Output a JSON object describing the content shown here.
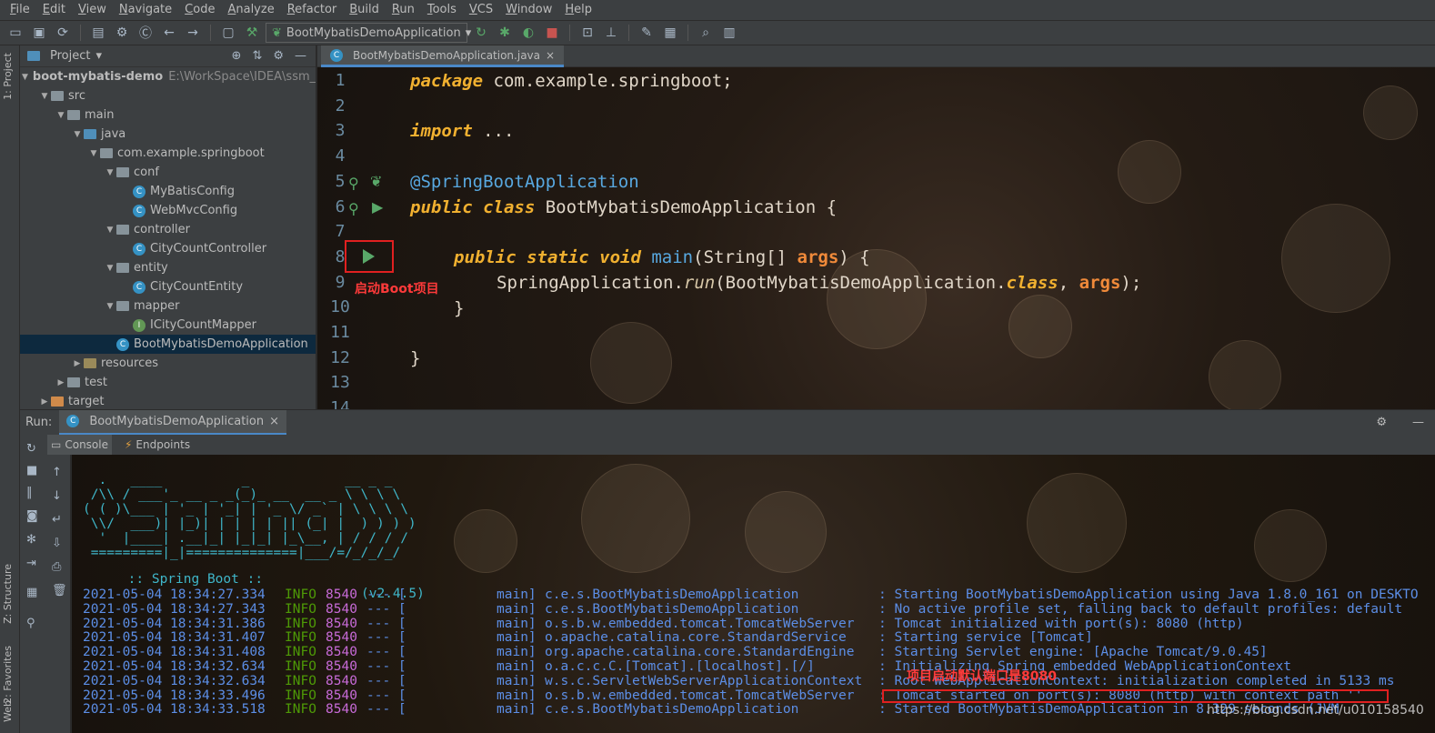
{
  "menu": [
    "File",
    "Edit",
    "View",
    "Navigate",
    "Code",
    "Analyze",
    "Refactor",
    "Build",
    "Run",
    "Tools",
    "VCS",
    "Window",
    "Help"
  ],
  "toolbar": {
    "run_config": "BootMybatisDemoApplication"
  },
  "left_strip": {
    "project_tab": "1: Project",
    "structure_tab": "Z: Structure",
    "favorites_tab": "2: Favorites",
    "web_tab": "Web"
  },
  "project": {
    "header": "Project",
    "root_name": "boot-mybatis-demo",
    "root_path": "E:\\WorkSpace\\IDEA\\ssm_de",
    "tree": [
      {
        "label": "src",
        "indent": 1
      },
      {
        "label": "main",
        "indent": 2
      },
      {
        "label": "java",
        "indent": 3
      },
      {
        "label": "com.example.springboot",
        "indent": 4
      },
      {
        "label": "conf",
        "indent": 5
      },
      {
        "label": "MyBatisConfig",
        "indent": 6
      },
      {
        "label": "WebMvcConfig",
        "indent": 6
      },
      {
        "label": "controller",
        "indent": 5
      },
      {
        "label": "CityCountController",
        "indent": 6
      },
      {
        "label": "entity",
        "indent": 5
      },
      {
        "label": "CityCountEntity",
        "indent": 6
      },
      {
        "label": "mapper",
        "indent": 5
      },
      {
        "label": "ICityCountMapper",
        "indent": 6
      },
      {
        "label": "BootMybatisDemoApplication",
        "indent": 5
      },
      {
        "label": "resources",
        "indent": 3
      },
      {
        "label": "test",
        "indent": 2
      },
      {
        "label": "target",
        "indent": 1
      }
    ]
  },
  "editor": {
    "tab_label": "BootMybatisDemoApplication.java",
    "line_numbers": [
      "1",
      "2",
      "3",
      "4",
      "5",
      "6",
      "7",
      "8",
      "9",
      "10",
      "11",
      "12",
      "13",
      "14"
    ],
    "code": {
      "l1_kw": "package",
      "l1_rest": " com.example.springboot;",
      "l3_kw": "import",
      "l3_rest": " ...",
      "l6": "@SpringBootApplication",
      "l7_kw": "public class",
      "l7_rest": " BootMybatisDemoApplication {",
      "l9_kw": "public static void",
      "l9_m": "main",
      "l9_a": "(String[] ",
      "l9_arg": "args",
      "l9_b": ") {",
      "l10_a": "SpringApplication.",
      "l10_run": "run",
      "l10_b": "(BootMybatisDemoApplication.",
      "l10_cls": "class",
      "l10_c": ", ",
      "l10_arg": "args",
      "l10_d": ");",
      "l11": "}",
      "l13": "}"
    },
    "annotation_label": "启动Boot项目"
  },
  "run_panel": {
    "run_label": "Run:",
    "tab_label": "BootMybatisDemoApplication",
    "console_tab": "Console",
    "endpoints_tab": "Endpoints",
    "banner": "  .   ____          _            __ _ _\n /\\\\ / ___'_ __ _ _(_)_ __  __ _ \\ \\ \\ \\\n( ( )\\___ | '_ | '_| | '_ \\/ _` | \\ \\ \\ \\\n \\\\/  ___)| |_)| | | | | || (_| |  ) ) ) )\n  '  |____| .__|_| |_|_| |_\\__, | / / / /\n =========|_|==============|___/=/_/_/_/",
    "boot_label": " :: Spring Boot :: ",
    "boot_version": "(v2.4.5)",
    "logs": [
      {
        "date": "2021-05-04 18:34:27.334",
        "level": "INFO",
        "pid": "8540",
        "sep": "--- [",
        "thread": "main]",
        "logger": "c.e.s.BootMybatisDemoApplication",
        "msg": ": Starting BootMybatisDemoApplication using Java 1.8.0_161 on DESKTO"
      },
      {
        "date": "2021-05-04 18:34:27.343",
        "level": "INFO",
        "pid": "8540",
        "sep": "--- [",
        "thread": "main]",
        "logger": "c.e.s.BootMybatisDemoApplication",
        "msg": ": No active profile set, falling back to default profiles: default"
      },
      {
        "date": "2021-05-04 18:34:31.386",
        "level": "INFO",
        "pid": "8540",
        "sep": "--- [",
        "thread": "main]",
        "logger": "o.s.b.w.embedded.tomcat.TomcatWebServer",
        "msg": ": Tomcat initialized with port(s): 8080 (http)"
      },
      {
        "date": "2021-05-04 18:34:31.407",
        "level": "INFO",
        "pid": "8540",
        "sep": "--- [",
        "thread": "main]",
        "logger": "o.apache.catalina.core.StandardService",
        "msg": ": Starting service [Tomcat]"
      },
      {
        "date": "2021-05-04 18:34:31.408",
        "level": "INFO",
        "pid": "8540",
        "sep": "--- [",
        "thread": "main]",
        "logger": "org.apache.catalina.core.StandardEngine",
        "msg": ": Starting Servlet engine: [Apache Tomcat/9.0.45]"
      },
      {
        "date": "2021-05-04 18:34:32.634",
        "level": "INFO",
        "pid": "8540",
        "sep": "--- [",
        "thread": "main]",
        "logger": "o.a.c.c.C.[Tomcat].[localhost].[/]",
        "msg": ": Initializing Spring embedded WebApplicationContext"
      },
      {
        "date": "2021-05-04 18:34:32.634",
        "level": "INFO",
        "pid": "8540",
        "sep": "--- [",
        "thread": "main]",
        "logger": "w.s.c.ServletWebServerApplicationContext",
        "msg": ": Root WebApplicationContext: initialization completed in 5133 ms"
      },
      {
        "date": "2021-05-04 18:34:33.496",
        "level": "INFO",
        "pid": "8540",
        "sep": "--- [",
        "thread": "main]",
        "logger": "o.s.b.w.embedded.tomcat.TomcatWebServer",
        "msg": ": Tomcat started on port(s): 8080 (http) with context path ''"
      },
      {
        "date": "2021-05-04 18:34:33.518",
        "level": "INFO",
        "pid": "8540",
        "sep": "--- [",
        "thread": "main]",
        "logger": "c.e.s.BootMybatisDemoApplication",
        "msg": ": Started BootMybatisDemoApplication in 8.329 seconds (JVM"
      }
    ],
    "highlight_label": "项目启动默认端口是8080",
    "watermark": "https://blog.csdn.net/u010158540"
  }
}
